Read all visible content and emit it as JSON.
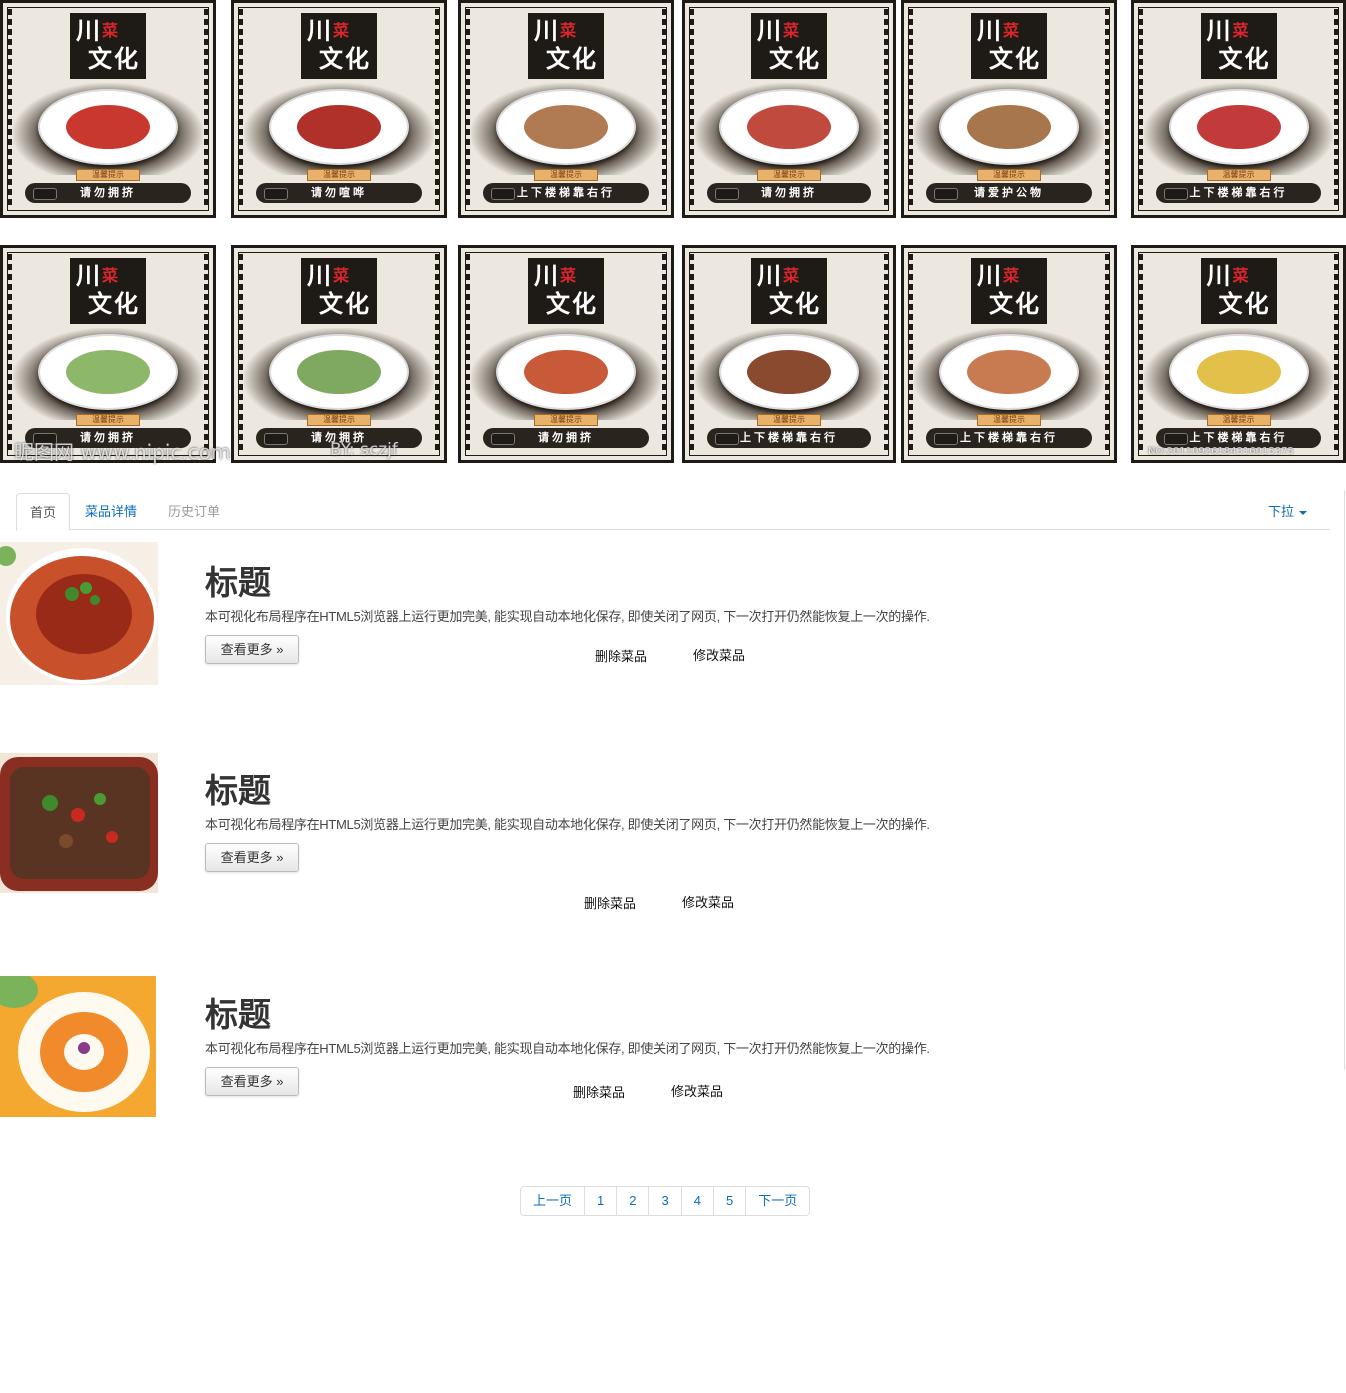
{
  "banner": {
    "poster_title": {
      "line1": "川",
      "red": "菜",
      "line2": "文化"
    },
    "badge_text": "温馨提示",
    "posters": [
      {
        "slogan": "请勿拥挤",
        "food_color": "#c8382e"
      },
      {
        "slogan": "请勿喧哗",
        "food_color": "#b0302a"
      },
      {
        "slogan": "上下楼梯靠右行",
        "food_color": "#b07a52"
      },
      {
        "slogan": "请勿拥挤",
        "food_color": "#c14a3e"
      },
      {
        "slogan": "请爱护公物",
        "food_color": "#a8764c"
      },
      {
        "slogan": "上下楼梯靠右行",
        "food_color": "#c23a3a"
      },
      {
        "slogan": "请勿拥挤",
        "food_color": "#8db86a"
      },
      {
        "slogan": "请勿拥挤",
        "food_color": "#7fa860"
      },
      {
        "slogan": "请勿拥挤",
        "food_color": "#c85a3a"
      },
      {
        "slogan": "上下楼梯靠右行",
        "food_color": "#8a4a30"
      },
      {
        "slogan": "上下楼梯靠右行",
        "food_color": "#c87a50"
      },
      {
        "slogan": "上下楼梯靠右行",
        "food_color": "#e2c04a"
      }
    ],
    "watermark_left": "昵图网 www.nipic.com",
    "watermark_by": "BY: sczjf",
    "watermark_right": "NO:20110926184316015375"
  },
  "nav": {
    "tabs": [
      {
        "label": "首页",
        "state": "active"
      },
      {
        "label": "菜品详情",
        "state": "link"
      },
      {
        "label": "历史订单",
        "state": "muted"
      }
    ],
    "dropdown_label": "下拉"
  },
  "dishes": [
    {
      "title": "标题",
      "description": "本可视化布局程序在HTML5浏览器上运行更加完美, 能实现自动本地化保存, 即使关闭了网页, 下一次打开仍然能恢复上一次的操作.",
      "more_label": "查看更多 »",
      "delete_label": "删除菜品",
      "edit_label": "修改菜品",
      "thumb_color": "#c8502a"
    },
    {
      "title": "标题",
      "description": "本可视化布局程序在HTML5浏览器上运行更加完美, 能实现自动本地化保存, 即使关闭了网页, 下一次打开仍然能恢复上一次的操作.",
      "more_label": "查看更多 »",
      "delete_label": "删除菜品",
      "edit_label": "修改菜品",
      "thumb_color": "#8a2e22"
    },
    {
      "title": "标题",
      "description": "本可视化布局程序在HTML5浏览器上运行更加完美, 能实现自动本地化保存, 即使关闭了网页, 下一次打开仍然能恢复上一次的操作.",
      "more_label": "查看更多 »",
      "delete_label": "删除菜品",
      "edit_label": "修改菜品",
      "thumb_color": "#f08a2a"
    }
  ],
  "pagination": {
    "prev": "上一页",
    "pages": [
      "1",
      "2",
      "3",
      "4",
      "5"
    ],
    "next": "下一页"
  },
  "colors": {
    "link": "#0a6ebd",
    "poster_frame": "#1e1a16",
    "poster_paper": "#ece8df"
  }
}
